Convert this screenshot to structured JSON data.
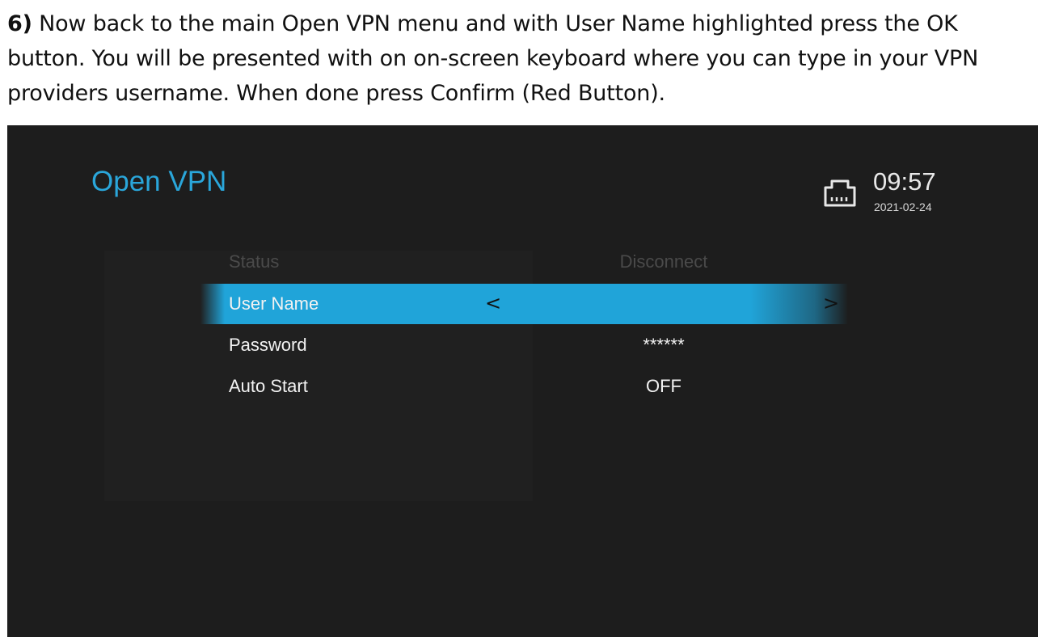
{
  "instruction": {
    "step_number": "6)",
    "text": " Now back to the main Open VPN menu and with User Name highlighted press the OK button. You will be presented with on on-screen keyboard where you can type in your VPN providers username. When done press Confirm (Red Button)."
  },
  "screen": {
    "title": "Open VPN",
    "status_icon": "network-ethernet-icon",
    "time": "09:57",
    "date": "2021-02-24",
    "accent_color": "#20a4d9",
    "menu": [
      {
        "label": "Status",
        "value": "Disconnect",
        "state": "disabled"
      },
      {
        "label": "User Name",
        "value": "",
        "state": "selected",
        "left_arrow": "<",
        "right_arrow": ">"
      },
      {
        "label": "Password",
        "value": "******",
        "state": "normal"
      },
      {
        "label": "Auto Start",
        "value": "OFF",
        "state": "normal"
      }
    ]
  }
}
